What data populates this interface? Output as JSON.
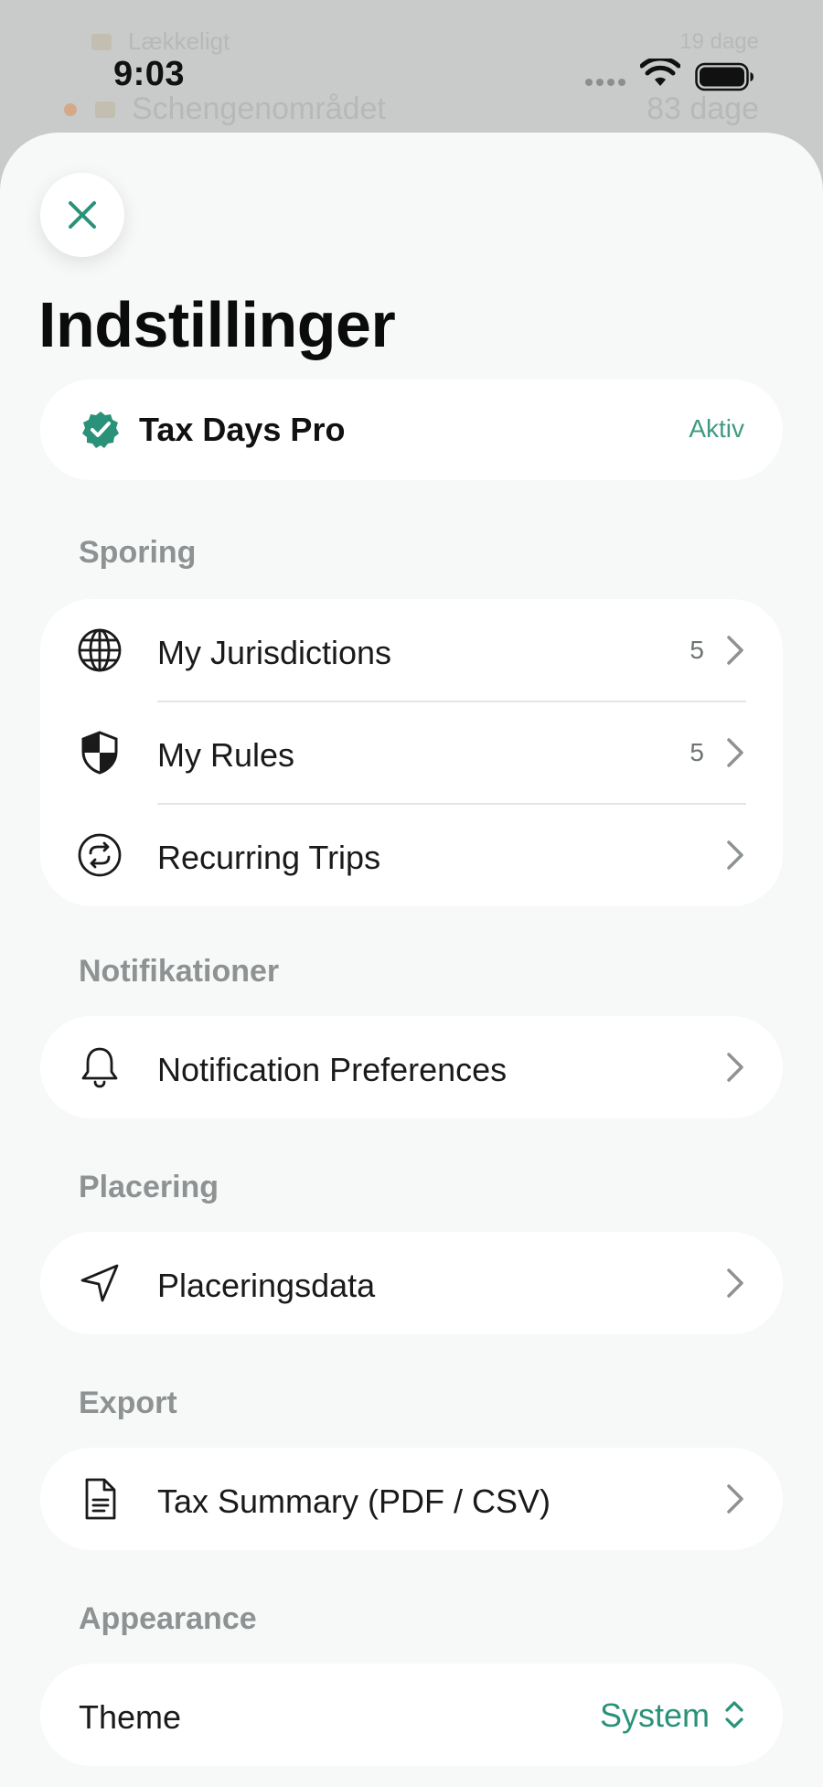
{
  "background_app": {
    "row1_label": "Lækkeligt",
    "row1_days": "19 dage",
    "row2_label": "Schengenområdet",
    "row2_days": "83 dage"
  },
  "status_bar": {
    "time": "9:03"
  },
  "sheet": {
    "title": "Indstillinger",
    "pro": {
      "name": "Tax Days Pro",
      "status": "Aktiv"
    },
    "sections": {
      "tracking": {
        "header": "Sporing",
        "items": [
          {
            "label": "My Jurisdictions",
            "count": "5",
            "icon": "globe-icon"
          },
          {
            "label": "My Rules",
            "count": "5",
            "icon": "shield-icon"
          },
          {
            "label": "Recurring Trips",
            "count": "",
            "icon": "repeat-icon"
          }
        ]
      },
      "notifications": {
        "header": "Notifikationer",
        "item": {
          "label": "Notification Preferences",
          "icon": "bell-icon"
        }
      },
      "location": {
        "header": "Placering",
        "item": {
          "label": "Placeringsdata",
          "icon": "location-arrow-icon"
        }
      },
      "export": {
        "header": "Export",
        "item": {
          "label": "Tax Summary (PDF / CSV)",
          "icon": "document-icon"
        }
      },
      "appearance": {
        "header": "Appearance",
        "theme_label": "Theme",
        "theme_value": "System"
      }
    }
  },
  "colors": {
    "accent": "#2a9278",
    "sheet_background": "#f7f8f8",
    "card_background": "#ffffff",
    "section_header": "#8e9292"
  }
}
